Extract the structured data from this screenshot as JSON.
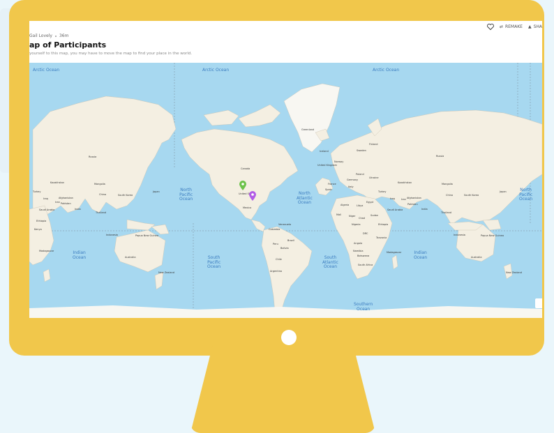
{
  "header": {
    "author": "Gail Lovely",
    "time": "36m",
    "title": "ap of Participants",
    "subtitle": "yourself to this map, you may have to move the map to find your place in the world.",
    "remake_label": "REMAKE",
    "share_label": "SHA"
  },
  "map": {
    "oceans": [
      {
        "name": "arctic-ocean-1",
        "label": "Arctic Ocean"
      },
      {
        "name": "arctic-ocean-2",
        "label": "Arctic Ocean"
      },
      {
        "name": "arctic-ocean-3",
        "label": "Arctic Ocean"
      },
      {
        "name": "north-pacific",
        "label": "North\nPacific\nOcean"
      },
      {
        "name": "north-atlantic",
        "label": "North\nAtlantic\nOcean"
      },
      {
        "name": "north-pacific-2",
        "label": "North\nPacific\nOcean"
      },
      {
        "name": "indian-ocean-1",
        "label": "Indian\nOcean"
      },
      {
        "name": "south-pacific",
        "label": "South\nPacific\nOcean"
      },
      {
        "name": "south-atlantic",
        "label": "South\nAtlantic\nOcean"
      },
      {
        "name": "indian-ocean-2",
        "label": "Indian\nOcean"
      },
      {
        "name": "southern-ocean",
        "label": "Southern\nOcean"
      }
    ],
    "places": [
      {
        "name": "greenland",
        "label": "Greenland"
      },
      {
        "name": "canada",
        "label": "Canada"
      },
      {
        "name": "united-states",
        "label": "United States"
      },
      {
        "name": "mexico",
        "label": "Mexico"
      },
      {
        "name": "russia-1",
        "label": "Russia"
      },
      {
        "name": "russia-2",
        "label": "Russia"
      },
      {
        "name": "china-1",
        "label": "China"
      },
      {
        "name": "china-2",
        "label": "China"
      },
      {
        "name": "australia-1",
        "label": "Australia"
      },
      {
        "name": "australia-2",
        "label": "Australia"
      },
      {
        "name": "brazil",
        "label": "Brazil"
      },
      {
        "name": "india-1",
        "label": "India"
      },
      {
        "name": "india-2",
        "label": "India"
      },
      {
        "name": "kazakhstan-1",
        "label": "Kazakhstan"
      },
      {
        "name": "kazakhstan-2",
        "label": "Kazakhstan"
      },
      {
        "name": "mongolia-1",
        "label": "Mongolia"
      },
      {
        "name": "mongolia-2",
        "label": "Mongolia"
      },
      {
        "name": "algeria",
        "label": "Algeria"
      },
      {
        "name": "libya",
        "label": "Libya"
      },
      {
        "name": "egypt",
        "label": "Egypt"
      },
      {
        "name": "niger",
        "label": "Niger"
      },
      {
        "name": "mali",
        "label": "Mali"
      },
      {
        "name": "chad",
        "label": "Chad"
      },
      {
        "name": "sudan",
        "label": "Sudan"
      },
      {
        "name": "nigeria",
        "label": "Nigeria"
      },
      {
        "name": "ethiopia",
        "label": "Ethiopia"
      },
      {
        "name": "drc",
        "label": "DRC"
      },
      {
        "name": "tanzania",
        "label": "Tanzania"
      },
      {
        "name": "angola",
        "label": "Angola"
      },
      {
        "name": "namibia",
        "label": "Namibia"
      },
      {
        "name": "botswana",
        "label": "Botswana"
      },
      {
        "name": "south-africa",
        "label": "South Africa"
      },
      {
        "name": "madagascar",
        "label": "Madagascar"
      },
      {
        "name": "peru",
        "label": "Peru"
      },
      {
        "name": "bolivia",
        "label": "Bolivia"
      },
      {
        "name": "chile",
        "label": "Chile"
      },
      {
        "name": "argentina",
        "label": "Argentina"
      },
      {
        "name": "colombia",
        "label": "Colombia"
      },
      {
        "name": "venezuela",
        "label": "Venezuela"
      },
      {
        "name": "finland",
        "label": "Finland"
      },
      {
        "name": "sweden",
        "label": "Sweden"
      },
      {
        "name": "norway",
        "label": "Norway"
      },
      {
        "name": "iceland",
        "label": "Iceland"
      },
      {
        "name": "united-kingdom",
        "label": "United Kingdom"
      },
      {
        "name": "poland",
        "label": "Poland"
      },
      {
        "name": "germany",
        "label": "Germany"
      },
      {
        "name": "ukraine",
        "label": "Ukraine"
      },
      {
        "name": "france",
        "label": "France"
      },
      {
        "name": "spain",
        "label": "Spain"
      },
      {
        "name": "italy",
        "label": "Italy"
      },
      {
        "name": "turkey-1",
        "label": "Turkey"
      },
      {
        "name": "turkey-2",
        "label": "Turkey"
      },
      {
        "name": "iraq-1",
        "label": "Iraq"
      },
      {
        "name": "iraq-2",
        "label": "Iraq"
      },
      {
        "name": "iran-1",
        "label": "Iran"
      },
      {
        "name": "iran-2",
        "label": "Iran"
      },
      {
        "name": "afghanistan-1",
        "label": "Afghanistan"
      },
      {
        "name": "afghanistan-2",
        "label": "Afghanistan"
      },
      {
        "name": "pakistan-1",
        "label": "Pakistan"
      },
      {
        "name": "pakistan-2",
        "label": "Pakistan"
      },
      {
        "name": "saudi-arabia-1",
        "label": "Saudi Arabia"
      },
      {
        "name": "saudi-arabia-2",
        "label": "Saudi Arabia"
      },
      {
        "name": "thailand-1",
        "label": "Thailand"
      },
      {
        "name": "thailand-2",
        "label": "Thailand"
      },
      {
        "name": "indonesia-1",
        "label": "Indonesia"
      },
      {
        "name": "indonesia-2",
        "label": "Indonesia"
      },
      {
        "name": "papua-1",
        "label": "Papua New Guinea"
      },
      {
        "name": "papua-2",
        "label": "Papua New Guinea"
      },
      {
        "name": "new-zealand-1",
        "label": "New Zealand"
      },
      {
        "name": "new-zealand-2",
        "label": "New Zealand"
      },
      {
        "name": "japan-1",
        "label": "Japan"
      },
      {
        "name": "japan-2",
        "label": "Japan"
      },
      {
        "name": "south-korea-1",
        "label": "South Korea"
      },
      {
        "name": "south-korea-2",
        "label": "South Korea"
      },
      {
        "name": "kenya-1",
        "label": "Kenya"
      },
      {
        "name": "ethiopia-2",
        "label": "Ethiopia"
      },
      {
        "name": "madagascar-2",
        "label": "Madagascar"
      }
    ],
    "pins": [
      {
        "name": "green-map-pin",
        "color": "#6cc24a"
      },
      {
        "name": "purple-map-pin",
        "color": "#b25ce6"
      }
    ]
  }
}
